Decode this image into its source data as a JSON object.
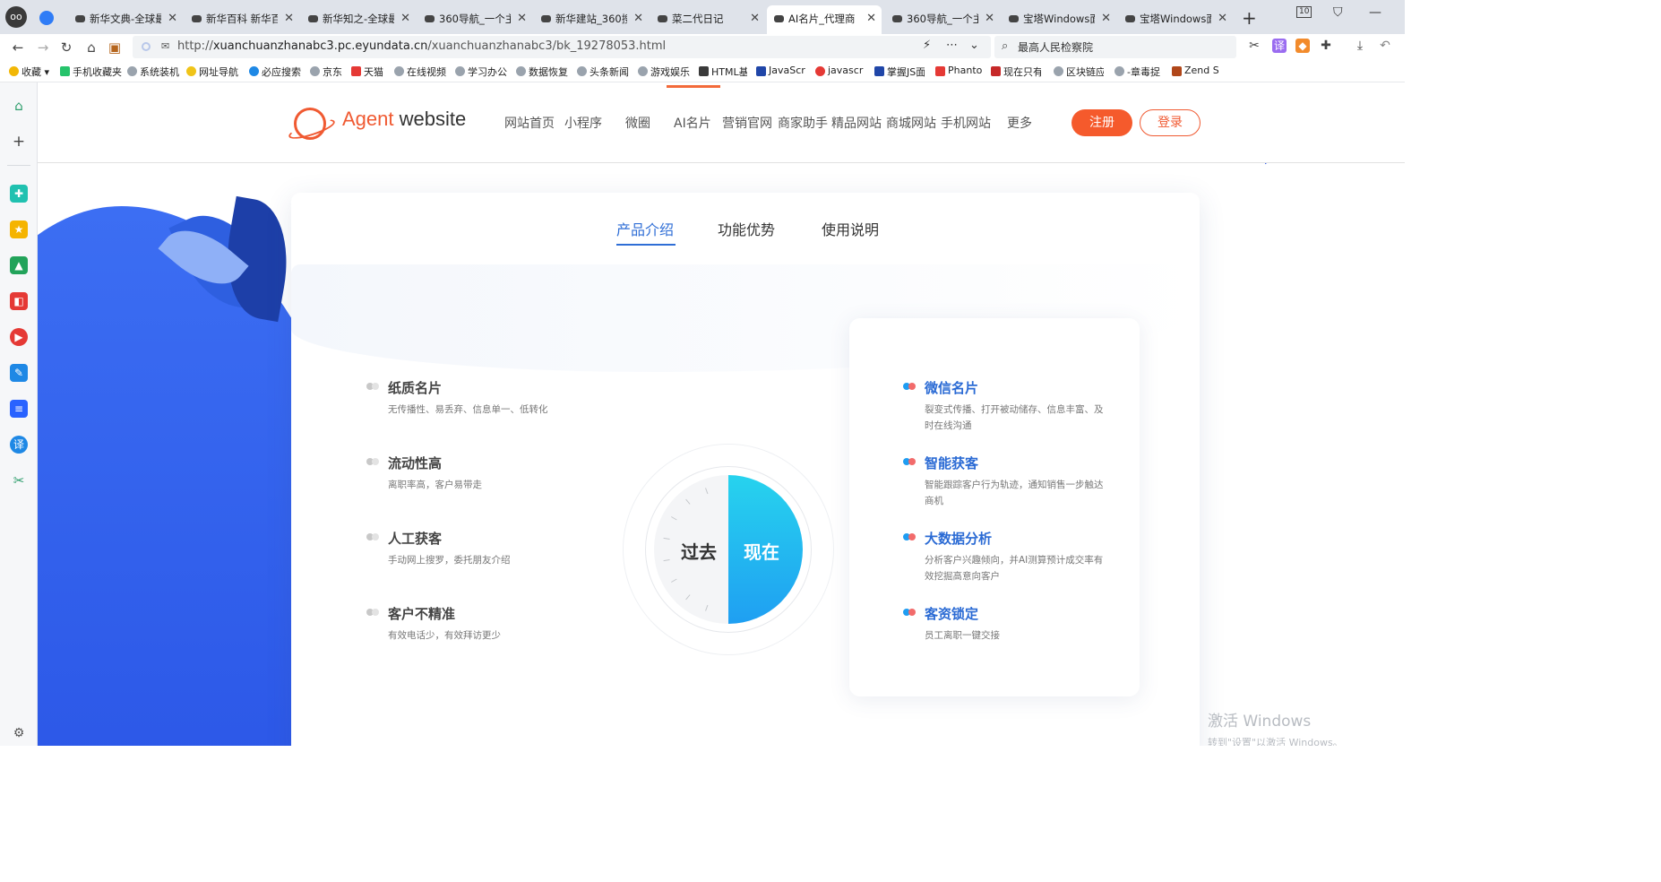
{
  "browser": {
    "tabs": [
      {
        "label": "新华文典-全球最",
        "left": 0
      },
      {
        "label": "新华百科 新华百",
        "left": 0
      },
      {
        "label": "新华知之-全球最",
        "left": 0
      },
      {
        "label": "360导航_一个主",
        "left": 0
      },
      {
        "label": "新华建站_360搜",
        "left": 0
      },
      {
        "label": "菜二代日记",
        "left": 0
      },
      {
        "label": "AI名片_代理商 ",
        "left": 0
      },
      {
        "label": "360导航_一个主",
        "left": 0
      },
      {
        "label": "宝塔Windows面",
        "left": 0
      },
      {
        "label": "宝塔Windows面",
        "left": 0
      }
    ],
    "tab_count": "10",
    "url_prefix": "http://",
    "url_host": "xuanchuanzhanabc3.pc.eyundata.cn",
    "url_path": "/xuanchuanzhanabc3/bk_19278053.html",
    "search_value": "最高人民检察院",
    "bookmarks": [
      "收藏",
      "手机收藏夹",
      "系统装机",
      "网址导航",
      "必应搜索",
      "京东",
      "天猫",
      "在线视频",
      "学习办公",
      "数据恢复",
      "头条新闻",
      "游戏娱乐",
      "HTML基",
      "JavaScr",
      "javascr",
      "掌握JS面",
      "Phanto",
      "现在只有",
      "区块链应",
      "-章毒捉",
      "Zend St"
    ]
  },
  "site": {
    "logo_main": "Agent",
    "logo_sub": "website",
    "menu": [
      "网站首页",
      "小程序",
      "微圈",
      "AI名片",
      "营销官网",
      "商家助手",
      "精品网站",
      "商城网站",
      "手机网站",
      "更多"
    ],
    "register": "注册",
    "login": "登录"
  },
  "card": {
    "tabs": [
      "产品介绍",
      "功能优势",
      "使用说明"
    ],
    "past_label": "过去",
    "now_label": "现在",
    "past_features": [
      {
        "title": "纸质名片",
        "desc": "无传播性、易丢弃、信息单一、低转化"
      },
      {
        "title": "流动性高",
        "desc": "离职率高，客户易带走"
      },
      {
        "title": "人工获客",
        "desc": "手动网上搜罗，委托朋友介绍"
      },
      {
        "title": "客户不精准",
        "desc": "有效电话少，有效拜访更少"
      }
    ],
    "now_features": [
      {
        "title": "微信名片",
        "desc": "裂变式传播、打开被动储存、信息丰富、及时在线沟通"
      },
      {
        "title": "智能获客",
        "desc": "智能跟踪客户行为轨迹，通知销售一步触达商机"
      },
      {
        "title": "大数据分析",
        "desc": "分析客户兴趣倾向，并AI测算预计成交率有效挖掘高意向客户"
      },
      {
        "title": "客资锁定",
        "desc": "员工离职一键交接"
      }
    ]
  },
  "watermark": {
    "line1": "激活 Windows",
    "line2": "转到\"设置\"以激活 Windows。"
  },
  "colors": {
    "brand_orange": "#f05a32",
    "accent_blue": "#2a6ad4",
    "dial_cyan": "#27d3ee"
  }
}
